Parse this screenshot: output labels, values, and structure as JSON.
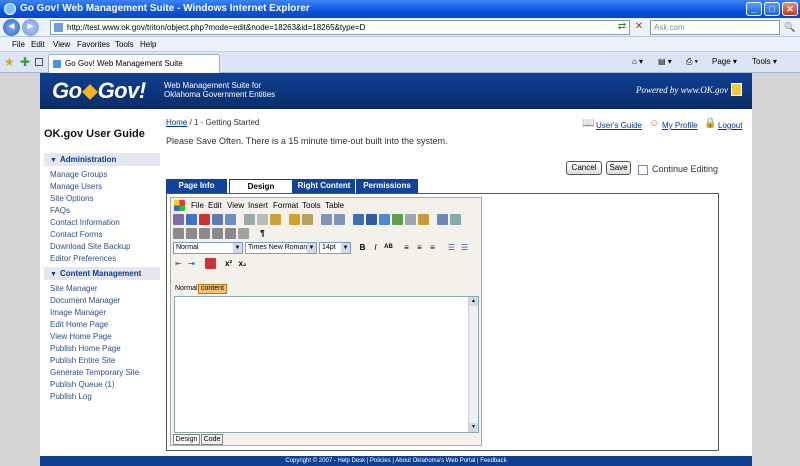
{
  "window": {
    "title": "Go Gov! Web Management Suite - Windows Internet Explorer",
    "minimize": "_",
    "maximize": "□",
    "close": "✕"
  },
  "address": {
    "back": "◄",
    "forward": "►",
    "url": "http://test.www.ok.gov/triton/object.php?mode=edit&node=18263&id=18265&type=D",
    "go": "⇄",
    "stop": "✕",
    "search_placeholder": "Ask.com",
    "search_btn": "🔍"
  },
  "menu": [
    "File",
    "Edit",
    "View",
    "Favorites",
    "Tools",
    "Help"
  ],
  "tabbar": {
    "tab_title": "Go Gov! Web Management Suite",
    "tools": [
      "Page ▾",
      "Tools ▾"
    ]
  },
  "header": {
    "logo_left": "Go",
    "logo_right": "Gov!",
    "tagline_1": "Web Management Suite for",
    "tagline_2": "Oklahoma Government Entities",
    "powered": "Powered by www.OK.gov"
  },
  "sidebar": {
    "title": "OK.gov User Guide",
    "sections": [
      {
        "label": "Administration",
        "items": [
          "Manage Groups",
          "Manage Users",
          "Site Options",
          "FAQs",
          "Contact Information",
          "Contact Forms",
          "Download Site Backup",
          "Editor Preferences"
        ]
      },
      {
        "label": "Content Management",
        "items": [
          "Site Manager",
          "Document Manager",
          "Image Manager",
          "Edit Home Page",
          "View Home Page",
          "Publish Home Page",
          "Publish Entire Site",
          "Generate Temporary Site",
          "Publish Queue (1)",
          "Publish Log"
        ]
      }
    ]
  },
  "content": {
    "breadcrumb_home": "Home",
    "breadcrumb_rest": " / 1 - Getting Started",
    "save_note": "Please Save Often. There is a 15 minute time-out built into the system.",
    "links": {
      "users_guide": "User's Guide",
      "my_profile": "My Profile",
      "logout": "Logout"
    },
    "cancel": "Cancel",
    "save": "Save",
    "continue_editing": "Continue Editing",
    "tabs": [
      "Page Info",
      "Design",
      "Right Content",
      "Permissions"
    ],
    "active_tab": "Design"
  },
  "editor": {
    "menu": [
      "File",
      "Edit",
      "View",
      "Insert",
      "Format",
      "Tools",
      "Table"
    ],
    "style_select": "Normal",
    "font_select": "Times New Roman",
    "size_select": "14pt",
    "format_buttons": [
      "B",
      "I",
      "AB"
    ],
    "path_normal": "Normal",
    "path_content": "content",
    "mode_design": "Design",
    "mode_code": "Code",
    "pilcrow": "¶",
    "superscript": "x²",
    "subscript": "x₂"
  },
  "footer": "Copyright © 2007 - Help Desk | Policies | About Oklahoma's Web Portal | Feedback"
}
